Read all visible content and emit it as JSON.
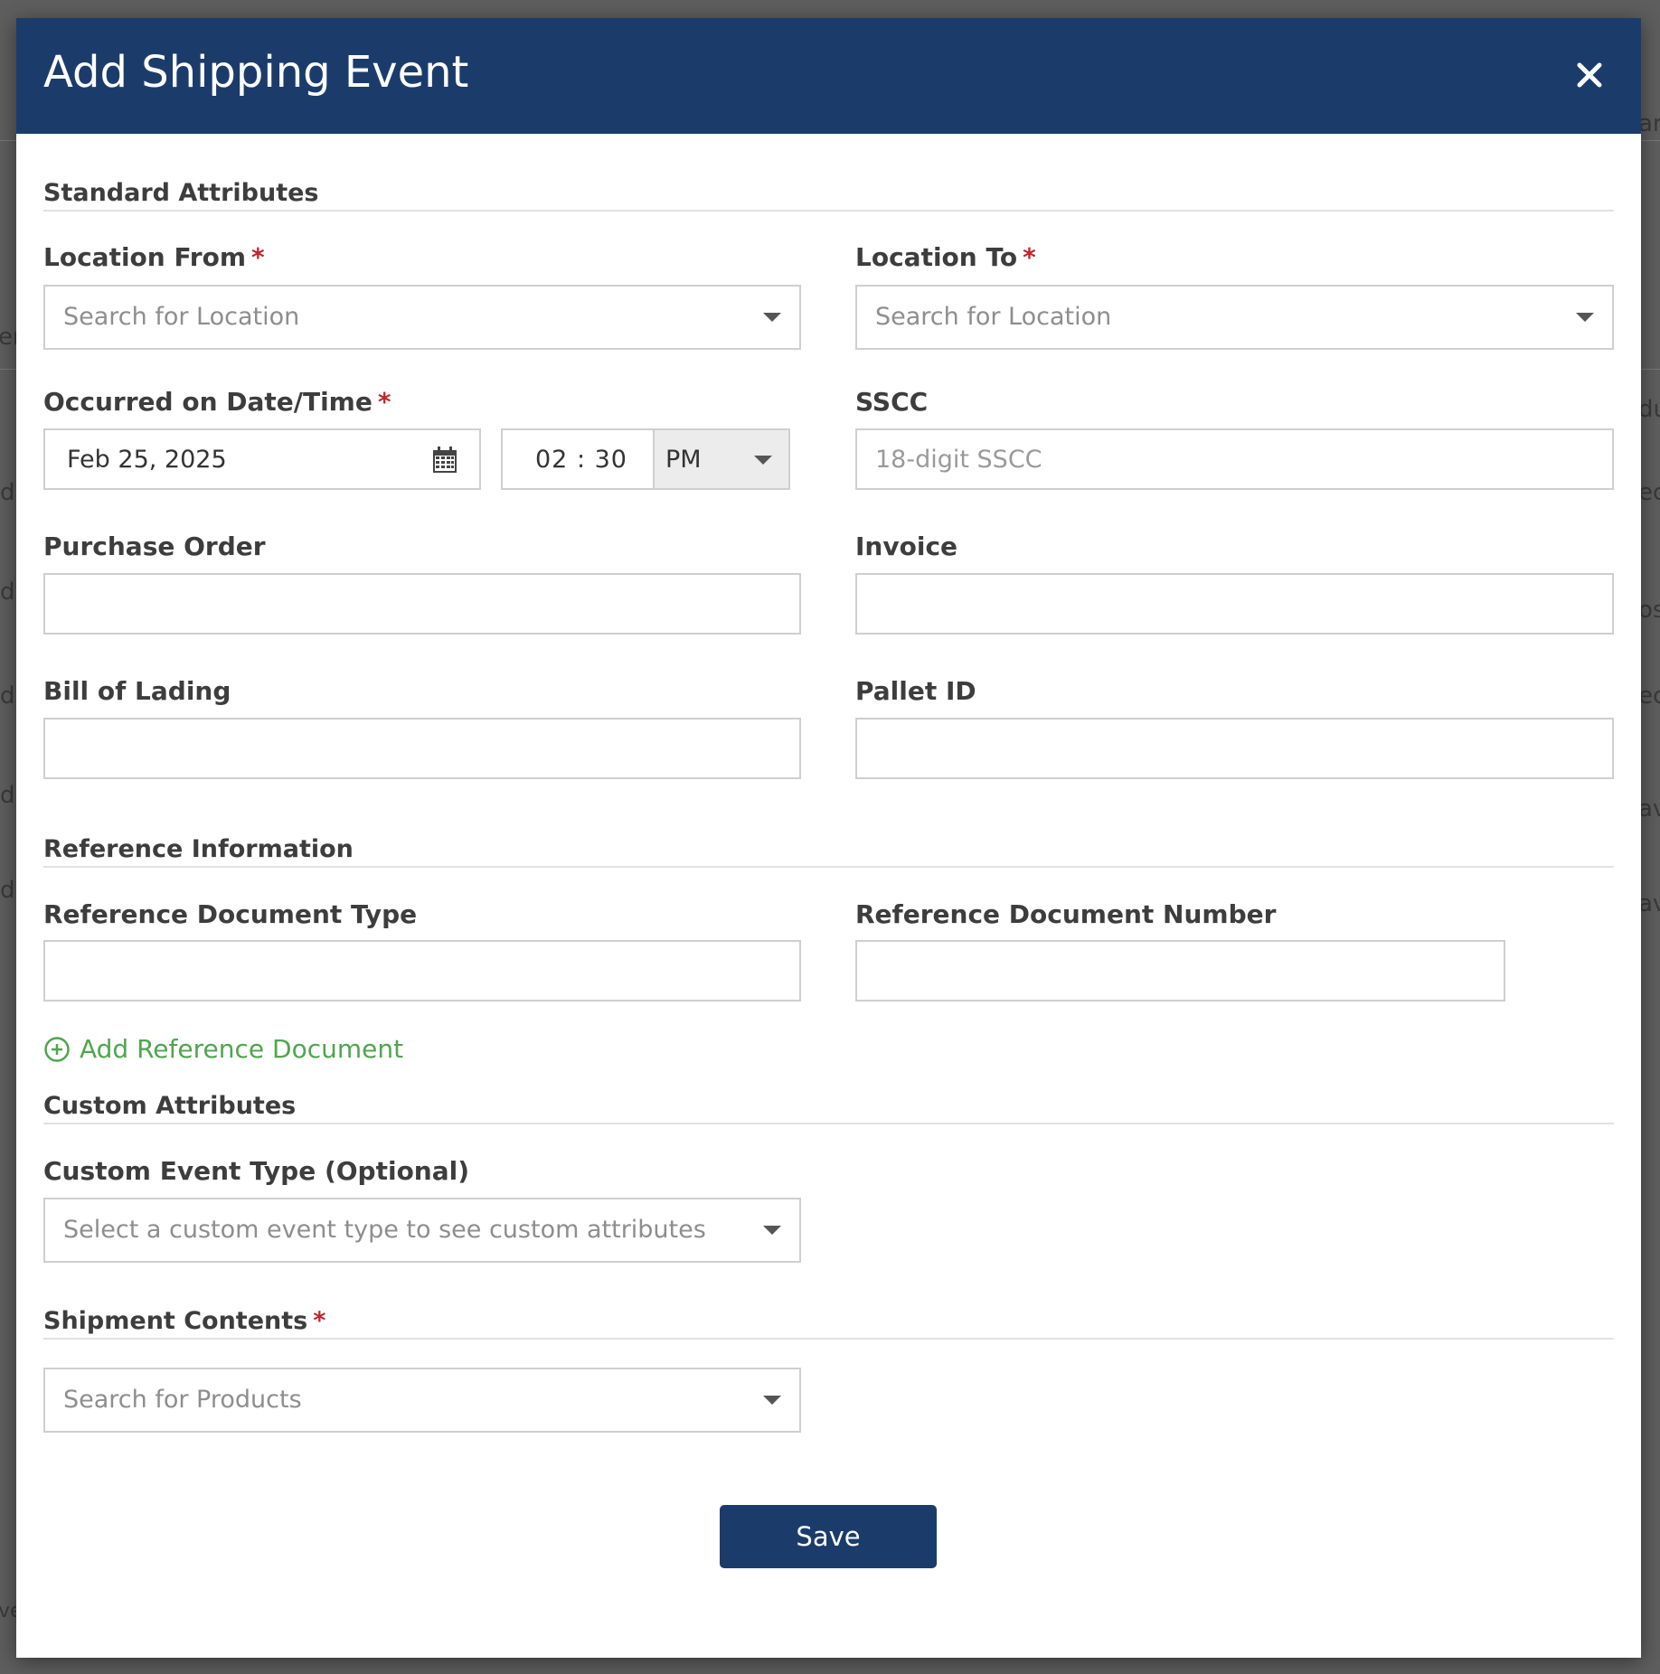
{
  "modal": {
    "title": "Add Shipping Event",
    "close_icon": "close-icon"
  },
  "background_fragments": [
    "er",
    "ar",
    "du",
    "d",
    "ec",
    "d",
    "os",
    "d",
    "ec",
    "d",
    "av",
    "d",
    "av",
    "ve"
  ],
  "sections": {
    "standard": "Standard Attributes",
    "reference": "Reference Information",
    "custom": "Custom Attributes",
    "shipment": "Shipment Contents"
  },
  "fields": {
    "location_from": {
      "label": "Location From",
      "required": "*",
      "placeholder": "Search for Location"
    },
    "location_to": {
      "label": "Location To",
      "required": "*",
      "placeholder": "Search for Location"
    },
    "occurred": {
      "label": "Occurred on Date/Time",
      "required": "*",
      "date": "Feb 25, 2025",
      "time": "02 : 30",
      "ampm": "PM",
      "calendar_icon": "calendar-icon"
    },
    "sscc": {
      "label": "SSCC",
      "placeholder": "18-digit SSCC",
      "value": ""
    },
    "purchase_order": {
      "label": "Purchase Order",
      "value": ""
    },
    "invoice": {
      "label": "Invoice",
      "value": ""
    },
    "bill_of_lading": {
      "label": "Bill of Lading",
      "value": ""
    },
    "pallet_id": {
      "label": "Pallet ID",
      "value": ""
    },
    "ref_doc_type": {
      "label": "Reference Document Type",
      "value": ""
    },
    "ref_doc_number": {
      "label": "Reference Document Number",
      "value": ""
    },
    "custom_event_type": {
      "label": "Custom Event Type (Optional)",
      "placeholder": "Select a custom event type to see custom attributes"
    },
    "shipment_products": {
      "required": "*",
      "placeholder": "Search for Products"
    }
  },
  "actions": {
    "add_reference": "Add Reference Document",
    "add_reference_icon": "plus-circle-icon",
    "save": "Save"
  },
  "colors": {
    "header": "#1b3c6b",
    "accent_green": "#4ea64e",
    "required": "#c0262b"
  }
}
